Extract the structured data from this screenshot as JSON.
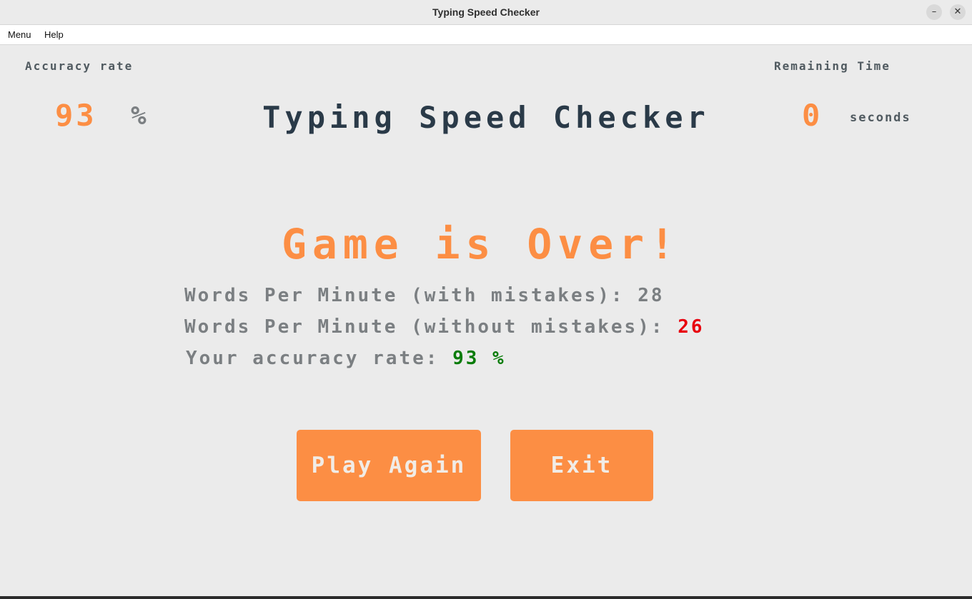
{
  "window": {
    "title": "Typing Speed Checker",
    "minimize_glyph": "–",
    "close_glyph": "✕"
  },
  "menubar": {
    "items": [
      {
        "label": "Menu"
      },
      {
        "label": "Help"
      }
    ]
  },
  "header": {
    "accuracy_label": "Accuracy rate",
    "accuracy_value": "93",
    "accuracy_unit": "%",
    "app_title": "Typing Speed Checker",
    "time_label": "Remaining Time",
    "time_value": "0",
    "time_unit": "seconds"
  },
  "results": {
    "heading": "Game is Over!",
    "wpm_with_label": "Words Per Minute (with mistakes):",
    "wpm_with_value": "28",
    "wpm_without_label": "Words Per Minute (without mistakes):",
    "wpm_without_value": "26",
    "accuracy_label": "Your accuracy rate:",
    "accuracy_value": "93 %"
  },
  "actions": {
    "play_again": "Play Again",
    "exit": "Exit"
  },
  "colors": {
    "accent": "#fc8e44",
    "error": "#e8000d",
    "success": "#0a7c0a",
    "text": "#7b7f82",
    "title": "#2a3a48"
  }
}
